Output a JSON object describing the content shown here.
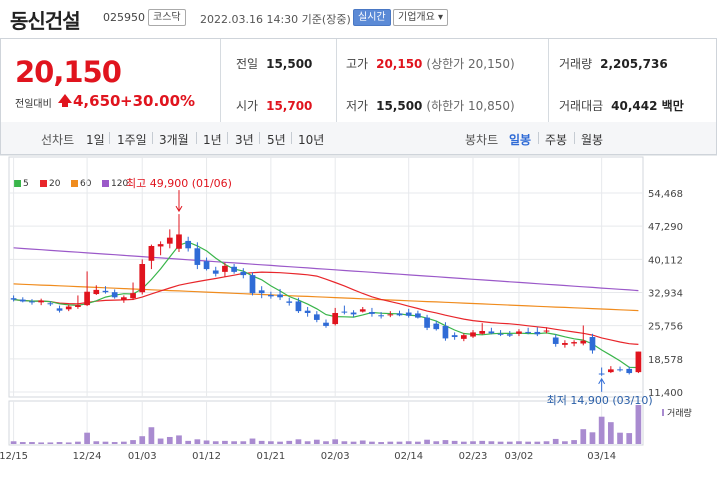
{
  "header": {
    "name": "동신건설",
    "code": "025950",
    "market": "코스닥",
    "datetime": "2022.03.16 14:30 기준(장중)",
    "realtime": "실시간",
    "company_info": "기업개요 ▾"
  },
  "summary": {
    "price": "20,150",
    "change_label": "전일대비",
    "change": "4,650",
    "change_pct": "+30.00%",
    "prev_close_label": "전일",
    "prev_close": "15,500",
    "high_label": "고가",
    "high": "20,150",
    "upper_limit": "(상한가 20,150)",
    "volume_label": "거래량",
    "volume": "2,205,736",
    "open_label": "시가",
    "open": "15,700",
    "low_label": "저가",
    "low": "15,500",
    "lower_limit": "(하한가 10,850)",
    "amount_label": "거래대금",
    "amount": "40,442 백만"
  },
  "tabs": {
    "line_label": "선차트",
    "periods": [
      "1일",
      "1주일",
      "3개월",
      "1년",
      "3년",
      "5년",
      "10년"
    ],
    "candle_label": "봉차트",
    "candle": [
      "일봉",
      "주봉",
      "월봉"
    ],
    "active": "일봉"
  },
  "colors": {
    "up": "#e0141e",
    "down": "#2f6bd6",
    "ma5": "#39b54a",
    "ma20": "#e8262b",
    "ma60": "#f08c1e",
    "ma120": "#9b59c9",
    "volume": "#a98bd0",
    "grid": "#e7e9ec"
  },
  "chart_data": {
    "type": "candlestick",
    "legend": [
      "5",
      "20",
      "60",
      "120"
    ],
    "y_ticks": [
      "54,468",
      "47,290",
      "40,112",
      "32,934",
      "25,756",
      "18,578",
      "11,400"
    ],
    "ylim": [
      11400,
      54468
    ],
    "x_ticks": [
      "12/15",
      "12/24",
      "01/03",
      "01/12",
      "01/21",
      "02/03",
      "02/14",
      "02/23",
      "03/02",
      "03/14"
    ],
    "volume_label": "거래량",
    "annotations": {
      "high": "최고 49,900 (01/06)",
      "low": "최저 14,900 (03/10)"
    },
    "candles": [
      {
        "o": 31700,
        "h": 32300,
        "l": 31000,
        "c": 31400
      },
      {
        "o": 31400,
        "h": 31900,
        "l": 30800,
        "c": 31000
      },
      {
        "o": 31000,
        "h": 31500,
        "l": 30300,
        "c": 30800
      },
      {
        "o": 30800,
        "h": 31600,
        "l": 30200,
        "c": 31200
      },
      {
        "o": 30600,
        "h": 31000,
        "l": 30000,
        "c": 30400
      },
      {
        "o": 29500,
        "h": 30100,
        "l": 28600,
        "c": 29000
      },
      {
        "o": 29300,
        "h": 30300,
        "l": 28900,
        "c": 29900
      },
      {
        "o": 29800,
        "h": 32300,
        "l": 29400,
        "c": 30200
      },
      {
        "o": 30200,
        "h": 37500,
        "l": 30000,
        "c": 33100
      },
      {
        "o": 32600,
        "h": 34500,
        "l": 32400,
        "c": 33500
      },
      {
        "o": 33300,
        "h": 34300,
        "l": 32700,
        "c": 33000
      },
      {
        "o": 33000,
        "h": 33600,
        "l": 31600,
        "c": 31900
      },
      {
        "o": 31300,
        "h": 32300,
        "l": 30700,
        "c": 31900
      },
      {
        "o": 31700,
        "h": 35100,
        "l": 31300,
        "c": 32800
      },
      {
        "o": 33000,
        "h": 40100,
        "l": 32500,
        "c": 39100
      },
      {
        "o": 39800,
        "h": 43300,
        "l": 38000,
        "c": 43000
      },
      {
        "o": 42900,
        "h": 44000,
        "l": 41000,
        "c": 43400
      },
      {
        "o": 43500,
        "h": 46600,
        "l": 42500,
        "c": 44800
      },
      {
        "o": 42400,
        "h": 49900,
        "l": 41700,
        "c": 45500
      },
      {
        "o": 44100,
        "h": 45000,
        "l": 41800,
        "c": 42500
      },
      {
        "o": 42500,
        "h": 43800,
        "l": 38000,
        "c": 38900
      },
      {
        "o": 39700,
        "h": 40500,
        "l": 37700,
        "c": 38000
      },
      {
        "o": 37700,
        "h": 38500,
        "l": 36400,
        "c": 37000
      },
      {
        "o": 37400,
        "h": 39400,
        "l": 36300,
        "c": 38700
      },
      {
        "o": 38500,
        "h": 39100,
        "l": 37000,
        "c": 37400
      },
      {
        "o": 37400,
        "h": 38200,
        "l": 36000,
        "c": 36700
      },
      {
        "o": 36700,
        "h": 37300,
        "l": 32300,
        "c": 32800
      },
      {
        "o": 33400,
        "h": 34300,
        "l": 31700,
        "c": 32800
      },
      {
        "o": 32400,
        "h": 33100,
        "l": 31600,
        "c": 32100
      },
      {
        "o": 32500,
        "h": 33700,
        "l": 31300,
        "c": 31900
      },
      {
        "o": 31000,
        "h": 31800,
        "l": 30100,
        "c": 30700
      },
      {
        "o": 31000,
        "h": 31800,
        "l": 28500,
        "c": 28900
      },
      {
        "o": 29000,
        "h": 29800,
        "l": 27700,
        "c": 28500
      },
      {
        "o": 28200,
        "h": 28900,
        "l": 26500,
        "c": 27000
      },
      {
        "o": 26400,
        "h": 27100,
        "l": 25300,
        "c": 25700
      },
      {
        "o": 26100,
        "h": 29600,
        "l": 25800,
        "c": 28500
      },
      {
        "o": 28800,
        "h": 30100,
        "l": 28200,
        "c": 28700
      },
      {
        "o": 28600,
        "h": 29100,
        "l": 27600,
        "c": 28200
      },
      {
        "o": 28800,
        "h": 29800,
        "l": 28600,
        "c": 29300
      },
      {
        "o": 28700,
        "h": 29600,
        "l": 27700,
        "c": 28300
      },
      {
        "o": 28000,
        "h": 28700,
        "l": 27300,
        "c": 27800
      },
      {
        "o": 28200,
        "h": 28900,
        "l": 27600,
        "c": 28200
      },
      {
        "o": 28400,
        "h": 29000,
        "l": 27800,
        "c": 28000
      },
      {
        "o": 28600,
        "h": 29400,
        "l": 27500,
        "c": 27900
      },
      {
        "o": 28400,
        "h": 29000,
        "l": 27300,
        "c": 27500
      },
      {
        "o": 27500,
        "h": 28100,
        "l": 24800,
        "c": 25300
      },
      {
        "o": 26200,
        "h": 26800,
        "l": 24700,
        "c": 25000
      },
      {
        "o": 25700,
        "h": 26500,
        "l": 22500,
        "c": 23000
      },
      {
        "o": 23700,
        "h": 24300,
        "l": 22700,
        "c": 23300
      },
      {
        "o": 22900,
        "h": 24100,
        "l": 22400,
        "c": 23700
      },
      {
        "o": 23400,
        "h": 24800,
        "l": 23100,
        "c": 24300
      },
      {
        "o": 24000,
        "h": 26300,
        "l": 23800,
        "c": 24600
      },
      {
        "o": 24500,
        "h": 25300,
        "l": 23900,
        "c": 24100
      },
      {
        "o": 24000,
        "h": 24800,
        "l": 23500,
        "c": 23800
      },
      {
        "o": 23900,
        "h": 24600,
        "l": 23300,
        "c": 23600
      },
      {
        "o": 24000,
        "h": 25000,
        "l": 23500,
        "c": 24500
      },
      {
        "o": 24400,
        "h": 25300,
        "l": 23900,
        "c": 24300
      },
      {
        "o": 24400,
        "h": 25400,
        "l": 23500,
        "c": 23900
      },
      {
        "o": 24500,
        "h": 25400,
        "l": 24100,
        "c": 24700
      },
      {
        "o": 23200,
        "h": 23900,
        "l": 21200,
        "c": 21800
      },
      {
        "o": 21600,
        "h": 22600,
        "l": 21000,
        "c": 22000
      },
      {
        "o": 21900,
        "h": 22600,
        "l": 21300,
        "c": 22200
      },
      {
        "o": 21900,
        "h": 25800,
        "l": 21500,
        "c": 22500
      },
      {
        "o": 23300,
        "h": 24000,
        "l": 19700,
        "c": 20400
      },
      {
        "o": 15400,
        "h": 16700,
        "l": 14900,
        "c": 15300
      },
      {
        "o": 15700,
        "h": 17000,
        "l": 15500,
        "c": 16300
      },
      {
        "o": 16300,
        "h": 16900,
        "l": 15800,
        "c": 16200
      },
      {
        "o": 16400,
        "h": 16900,
        "l": 15200,
        "c": 15500
      },
      {
        "o": 15700,
        "h": 20150,
        "l": 15500,
        "c": 20150
      }
    ],
    "volume": [
      0.07,
      0.05,
      0.05,
      0.04,
      0.04,
      0.05,
      0.04,
      0.06,
      0.29,
      0.07,
      0.06,
      0.05,
      0.06,
      0.1,
      0.2,
      0.43,
      0.14,
      0.18,
      0.22,
      0.08,
      0.12,
      0.09,
      0.07,
      0.08,
      0.07,
      0.07,
      0.14,
      0.08,
      0.07,
      0.06,
      0.08,
      0.12,
      0.07,
      0.11,
      0.07,
      0.12,
      0.07,
      0.06,
      0.09,
      0.06,
      0.05,
      0.06,
      0.06,
      0.07,
      0.06,
      0.11,
      0.07,
      0.1,
      0.08,
      0.06,
      0.07,
      0.08,
      0.07,
      0.06,
      0.06,
      0.07,
      0.06,
      0.06,
      0.07,
      0.13,
      0.07,
      0.1,
      0.38,
      0.3,
      0.7,
      0.56,
      0.29,
      0.28,
      1.0
    ]
  }
}
